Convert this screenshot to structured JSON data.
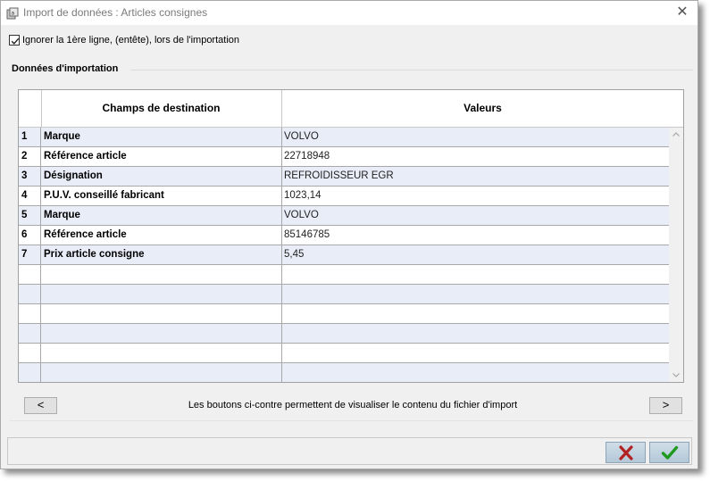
{
  "window": {
    "title": "Import de données : Articles consignes",
    "close_symbol": "✕"
  },
  "options": {
    "ignore_first_line_label": "Ignorer la 1ère ligne, (entête), lors de l'importation",
    "ignore_first_line_checked": true
  },
  "group": {
    "title": "Données d'importation"
  },
  "grid": {
    "columns": [
      "",
      "Champs de destination",
      "Valeurs"
    ],
    "rows": [
      {
        "n": "1",
        "field": "Marque",
        "value": "VOLVO"
      },
      {
        "n": "2",
        "field": "Référence article",
        "value": "22718948"
      },
      {
        "n": "3",
        "field": "Désignation",
        "value": "REFROIDISSEUR EGR"
      },
      {
        "n": "4",
        "field": "P.U.V. conseillé fabricant",
        "value": "1023,14"
      },
      {
        "n": "5",
        "field": "Marque",
        "value": "VOLVO"
      },
      {
        "n": "6",
        "field": "Référence article",
        "value": "85146785"
      },
      {
        "n": "7",
        "field": "Prix article consigne",
        "value": "5,45"
      }
    ]
  },
  "navigation": {
    "prev_label": "<",
    "next_label": ">",
    "info": "Les boutons ci-contre permettent de visualiser le contenu du fichier d'import"
  },
  "footer": {
    "cancel_icon": "red-x-icon",
    "ok_icon": "green-check-icon",
    "cancel_color": "#b22222",
    "ok_color": "#1f9a1f"
  }
}
